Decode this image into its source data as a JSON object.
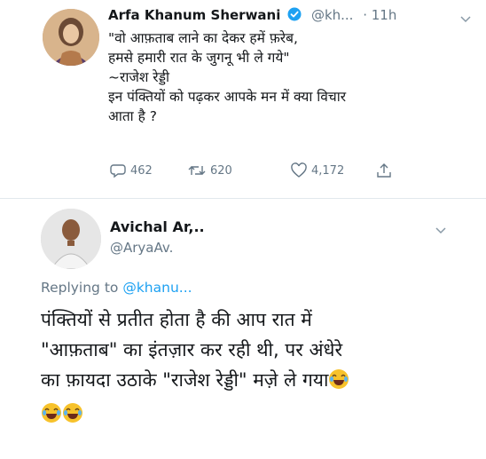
{
  "tweet": {
    "author_name": "Arfa Khanum Sherwani",
    "handle": "@kh...",
    "time": "· 11h",
    "lines": [
      "\"वो आफ़ताब लाने का देकर हमें फ़रेब,",
      "हमसे हमारी रात के जुगनू भी ले गये\"",
      "~राजेश रेड्डी",
      "इन पंक्तियों को पढ़कर आपके मन में क्या विचार",
      "आता है ?"
    ],
    "replies": "462",
    "retweets": "620",
    "likes": "4,172"
  },
  "reply": {
    "author_name": "Avichal Ar,..",
    "handle": "@AryaAv.",
    "replying_prefix": "Replying to",
    "replying_handle": "@khanu...",
    "lines": [
      "पंक्तियों से प्रतीत होता है की आप रात में",
      "\"आफ़ताब\" का इंतज़ार कर रही थी, पर अंधेरे",
      "का फ़ायदा उठाके \"राजेश रेड्डी\" मज़े ले गया"
    ],
    "emoji_names": [
      "laughing-emoji",
      "laughing-emoji",
      "laughing-emoji"
    ]
  },
  "colors": {
    "muted": "#657786",
    "link": "#1da1f2",
    "text": "#14171a",
    "divider": "#e1e8ed",
    "emoji": "#f7c22b"
  }
}
